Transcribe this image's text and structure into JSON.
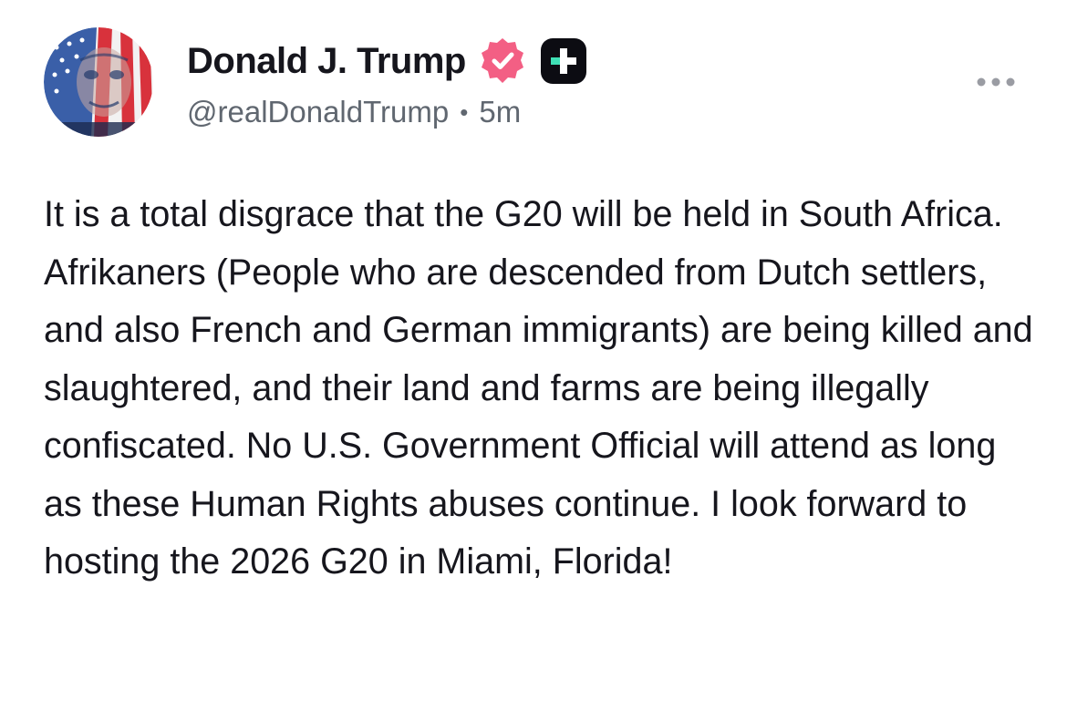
{
  "post": {
    "author": {
      "display_name": "Donald J. Trump",
      "handle": "@realDonaldTrump",
      "verified": true,
      "badge_icon": "verified-badge-icon",
      "plus_icon": "truth-plus-icon",
      "avatar_icon": "avatar-flag-portrait"
    },
    "separator": "•",
    "time_ago": "5m",
    "more_icon": "more-options-icon",
    "text": "It is a total disgrace that the G20 will be held in South Africa. Afrikaners (People who are descended from Dutch settlers, and also French and German immigrants) are being killed and slaughtered, and their land and farms are being illegally confiscated. No U.S. Government Official will attend as long as these Human Rights abuses continue. I look forward to hosting the 2026 G20 in Miami, Florida!"
  },
  "colors": {
    "badge_pink": "#F35F84",
    "plus_black": "#0C0C12",
    "plus_accent": "#3FE0B5",
    "muted_text": "#606770",
    "body_text": "#16161D"
  }
}
